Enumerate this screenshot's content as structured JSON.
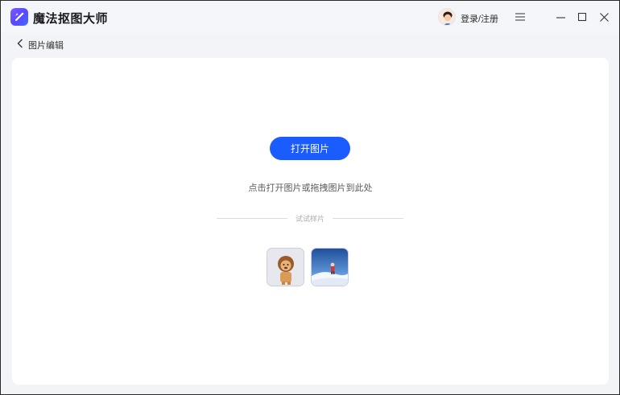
{
  "app": {
    "title": "魔法抠图大师"
  },
  "header": {
    "login_label": "登录/注册"
  },
  "nav": {
    "back_label": "图片编辑"
  },
  "main": {
    "open_button_label": "打开图片",
    "hint_text": "点击打开图片或拖拽图片到此处",
    "samples_label": "试试样片",
    "samples": [
      {
        "name": "lion-toy-sample"
      },
      {
        "name": "snow-scene-sample"
      }
    ]
  },
  "colors": {
    "accent": "#1b5cff",
    "logo_gradient_start": "#7b5cff",
    "logo_gradient_end": "#3f6bff",
    "panel_bg": "#ffffff",
    "window_bg": "#f2f4f7"
  },
  "icons": {
    "logo": "magic-wand-logo-icon",
    "menu": "hamburger-menu-icon",
    "minimize": "minimize-icon",
    "maximize": "maximize-icon",
    "close": "close-icon",
    "back": "chevron-left-icon"
  }
}
